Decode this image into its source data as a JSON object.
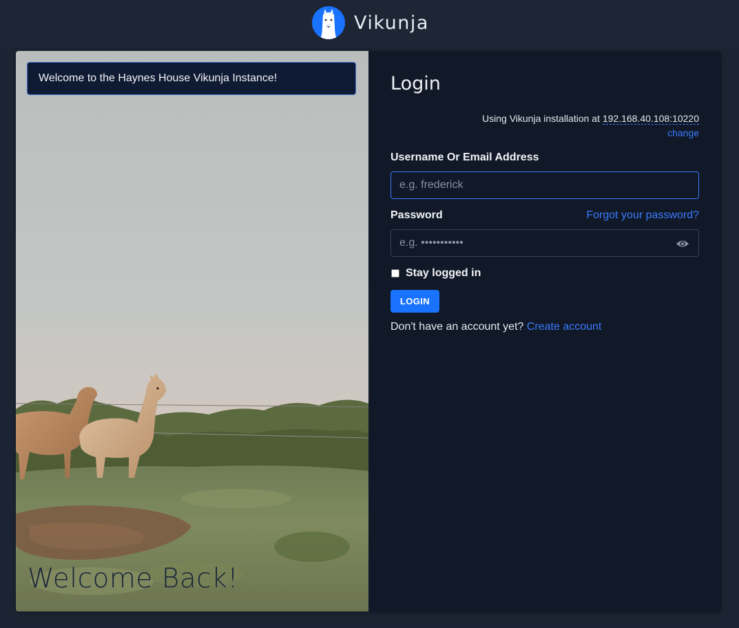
{
  "app": {
    "name": "Vikunja",
    "logo_icon": "llama-logo-icon",
    "accent_color": "#1973ff"
  },
  "motd": "Welcome to the Haynes House Vikunja Instance!",
  "hero": {
    "welcome_text": "Welcome Back!"
  },
  "login": {
    "title": "Login",
    "install_prefix": "Using Vikunja installation at",
    "install_address": "192.168.40.108:10220",
    "change_label": "change",
    "username_label": "Username Or Email Address",
    "username_placeholder": "e.g. frederick",
    "password_label": "Password",
    "forgot_label": "Forgot your password?",
    "password_placeholder": "e.g. •••••••••••",
    "show_password_icon": "eye-icon",
    "stay_logged_in_label": "Stay logged in",
    "stay_logged_in_checked": false,
    "submit_label": "LOGIN",
    "signup_prompt": "Don't have an account yet?",
    "signup_link": "Create account"
  }
}
